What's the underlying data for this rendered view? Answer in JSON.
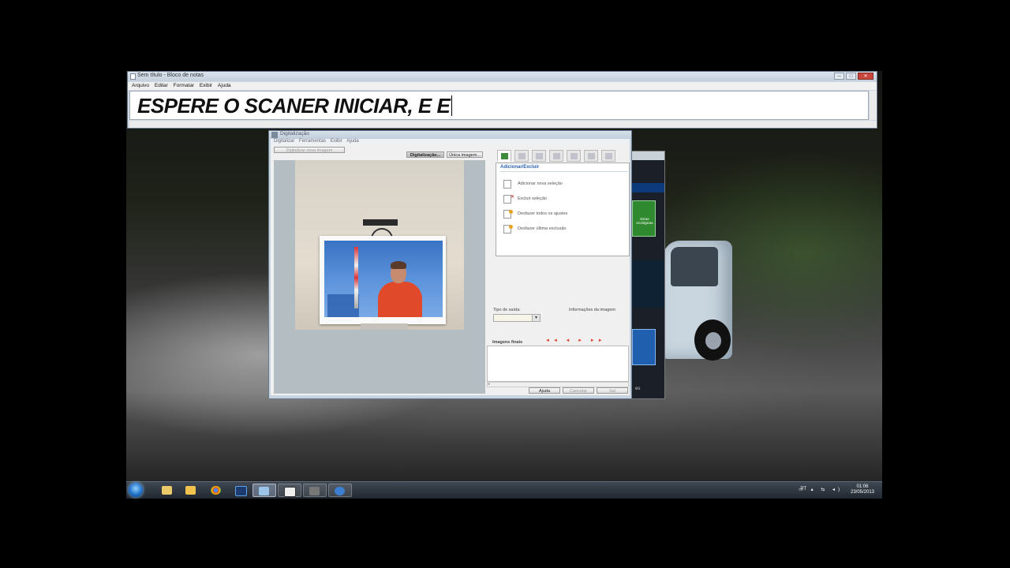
{
  "notepad": {
    "title": "Sem título - Bloco de notas",
    "menu": [
      "Arquivo",
      "Editar",
      "Formatar",
      "Exibir",
      "Ajuda"
    ],
    "content": "ESPERE O SCANER INICIAR, E E",
    "window_buttons": {
      "minimize": "─",
      "maximize": "□",
      "close": "✕"
    }
  },
  "scan": {
    "title": "Digitalização",
    "menu": [
      "Digitalizar",
      "Ferramentas",
      "Exibir",
      "Ajuda"
    ],
    "scan_new_button": "Digitalizar nova imagem",
    "scan_button": "Digitalização...",
    "single_image_button": "Única imagem...",
    "tabs": [
      "add-select-icon",
      "page-icon",
      "crop-icon",
      "frame-icon",
      "book-icon",
      "adjust-icon",
      "tools-icon"
    ],
    "panel_title": "Adicionar/Excluir",
    "actions": [
      {
        "label": "Adicionar nova seleção",
        "icon": "add-selection-icon"
      },
      {
        "label": "Excluir seleção",
        "icon": "delete-selection-icon"
      },
      {
        "label": "Desfazer todos os ajustes",
        "icon": "undo-all-icon"
      },
      {
        "label": "Desfazer última exclusão",
        "icon": "undo-last-icon"
      }
    ],
    "output_type_label": "Tipo de saída:",
    "image_info_label": "Informações da imagem",
    "final_images_label": "Imagens finais",
    "nav_glyphs": "◄◄ ◄ ► ►►",
    "help_button": "Ajuda",
    "cancel_button": "Cancelar",
    "save_button": "Sal"
  },
  "background_window": {
    "green_tile": "Dicas ecológicas",
    "bottom_label": "es"
  },
  "taskbar": {
    "items": [
      "start-orb",
      "explorer-icon",
      "folder-icon",
      "chrome-icon",
      "photoshop-icon",
      "window-icon",
      "scanner-icon",
      "app-icon",
      "settings-icon"
    ],
    "language": "PT",
    "time": "01:06",
    "date": "23/05/2013"
  },
  "colors": {
    "accent_blue": "#2a62b0",
    "taskbar": "#2a313a",
    "nav_red": "#dd4433",
    "close_red": "#c9463d"
  }
}
